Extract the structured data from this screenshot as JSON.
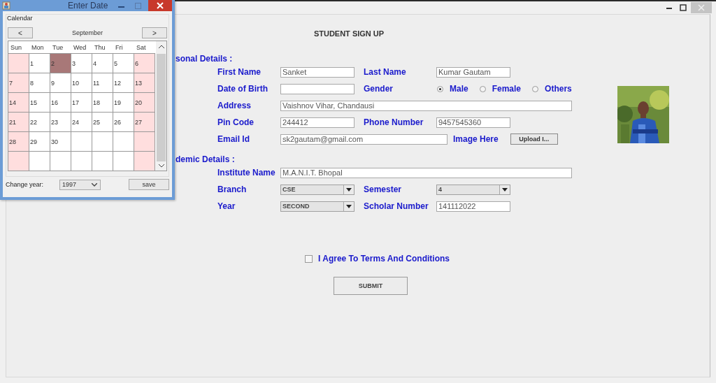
{
  "dialog": {
    "title": "Enter Date",
    "group_label": "Calendar",
    "prev": "<",
    "next": ">",
    "month": "September",
    "weekdays": [
      "Sun",
      "Mon",
      "Tue",
      "Wed",
      "Thu",
      "Fri",
      "Sat"
    ],
    "weeks": [
      [
        {
          "selected": false
        },
        {
          "day": "1",
          "selected": false
        },
        {
          "day": "2",
          "selected": true
        },
        {
          "day": "3",
          "selected": false
        },
        {
          "day": "4",
          "selected": false
        },
        {
          "day": "5",
          "selected": false
        },
        {
          "day": "6",
          "selected": false
        }
      ],
      [
        {
          "day": "7",
          "selected": false
        },
        {
          "day": "8",
          "selected": false
        },
        {
          "day": "9",
          "selected": false
        },
        {
          "day": "10",
          "selected": false
        },
        {
          "day": "11",
          "selected": false
        },
        {
          "day": "12",
          "selected": false
        },
        {
          "day": "13",
          "selected": false
        }
      ],
      [
        {
          "day": "14",
          "selected": false
        },
        {
          "day": "15",
          "selected": false
        },
        {
          "day": "16",
          "selected": false
        },
        {
          "day": "17",
          "selected": false
        },
        {
          "day": "18",
          "selected": false
        },
        {
          "day": "19",
          "selected": false
        },
        {
          "day": "20",
          "selected": false
        }
      ],
      [
        {
          "day": "21",
          "selected": false
        },
        {
          "day": "22",
          "selected": false
        },
        {
          "day": "23",
          "selected": false
        },
        {
          "day": "24",
          "selected": false
        },
        {
          "day": "25",
          "selected": false
        },
        {
          "day": "26",
          "selected": false
        },
        {
          "day": "27",
          "selected": false
        }
      ],
      [
        {
          "day": "28",
          "selected": false
        },
        {
          "day": "29",
          "selected": false
        },
        {
          "day": "30",
          "selected": false
        },
        {
          "selected": false
        },
        {
          "selected": false
        },
        {
          "selected": false
        },
        {
          "selected": false
        }
      ],
      [
        {
          "selected": false
        },
        {
          "selected": false
        },
        {
          "selected": false
        },
        {
          "selected": false
        },
        {
          "selected": false
        },
        {
          "selected": false
        },
        {
          "selected": false
        }
      ]
    ],
    "year_label": "Change year:",
    "year": "1997",
    "save": "save"
  },
  "form": {
    "title": "STUDENT SIGN UP",
    "personal": {
      "heading": "sonal Details  :",
      "first_name": {
        "label": "First Name",
        "value": "Sanket"
      },
      "last_name": {
        "label": "Last Name",
        "value": "Kumar Gautam"
      },
      "dob": {
        "label": "Date of Birth"
      },
      "gender": {
        "label": "Gender",
        "options": [
          {
            "label": "Male",
            "selected": true
          },
          {
            "label": "Female",
            "selected": false
          },
          {
            "label": "Others",
            "selected": false
          }
        ]
      },
      "address": {
        "label": "Address",
        "value": "Vaishnov Vihar, Chandausi"
      },
      "pin_code": {
        "label": "Pin Code",
        "value": "244412"
      },
      "phone": {
        "label": "Phone Number",
        "value": "9457545360"
      },
      "email": {
        "label": "Email Id",
        "value": "sk2gautam@gmail.com"
      },
      "image": {
        "label": "Image Here",
        "button": "Upload I..."
      }
    },
    "academic": {
      "heading": "demic Details  :",
      "institute": {
        "label": "Institute Name",
        "value": "M.A.N.I.T. Bhopal"
      },
      "branch": {
        "label": "Branch",
        "value": "CSE"
      },
      "semester": {
        "label": "Semester",
        "value": "4"
      },
      "year": {
        "label": "Year",
        "value": "SECOND"
      },
      "scholar": {
        "label": "Scholar Number",
        "value": "141112022"
      }
    },
    "agree": {
      "label": "I Agree To Terms And Conditions",
      "checked": false
    },
    "submit": "SUBMIT"
  }
}
